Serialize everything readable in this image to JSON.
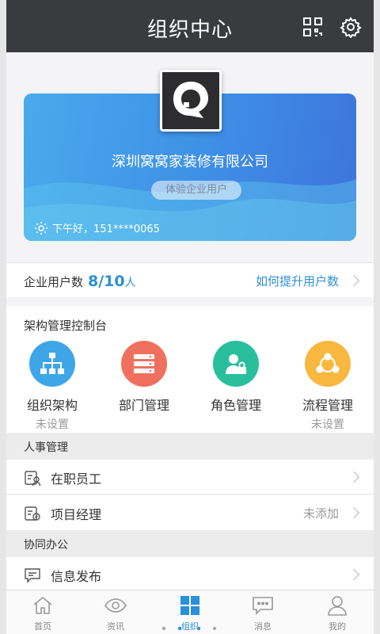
{
  "header": {
    "title": "组织中心",
    "qr_icon": "qr-code-icon",
    "settings_icon": "gear-icon"
  },
  "org_card": {
    "company_name": "深圳窝窝家装修有限公司",
    "badge": "体验企业用户",
    "greeting": "下午好，151****0065",
    "colors": {
      "gradient_start": "#4aa9ec",
      "gradient_end": "#3d74db"
    }
  },
  "enterprise_users": {
    "label": "企业用户数",
    "count": "8/10",
    "unit": "人",
    "upgrade_link": "如何提升用户数"
  },
  "console": {
    "title": "架构管理控制台",
    "tiles": [
      {
        "label": "组织架构",
        "status": "未设置",
        "icon": "org-chart-icon",
        "color": "#3ea6e8"
      },
      {
        "label": "部门管理",
        "status": "",
        "icon": "department-list-icon",
        "color": "#f0705f"
      },
      {
        "label": "角色管理",
        "status": "",
        "icon": "role-lock-icon",
        "color": "#29bf9c"
      },
      {
        "label": "流程管理",
        "status": "未设置",
        "icon": "workflow-icon",
        "color": "#f8b73e"
      }
    ]
  },
  "hr": {
    "title": "人事管理",
    "items": [
      {
        "label": "在职员工",
        "extra": ""
      },
      {
        "label": "项目经理",
        "extra": "未添加"
      }
    ]
  },
  "collab": {
    "title": "协同办公",
    "items": [
      {
        "label": "信息发布"
      }
    ]
  },
  "tabbar": {
    "active": "组织",
    "tabs": [
      {
        "label": "首页",
        "icon": "home-icon"
      },
      {
        "label": "资讯",
        "icon": "eye-icon"
      },
      {
        "label": "组织",
        "icon": "grid-icon"
      },
      {
        "label": "消息",
        "icon": "chat-icon"
      },
      {
        "label": "我的",
        "icon": "user-icon"
      }
    ]
  }
}
